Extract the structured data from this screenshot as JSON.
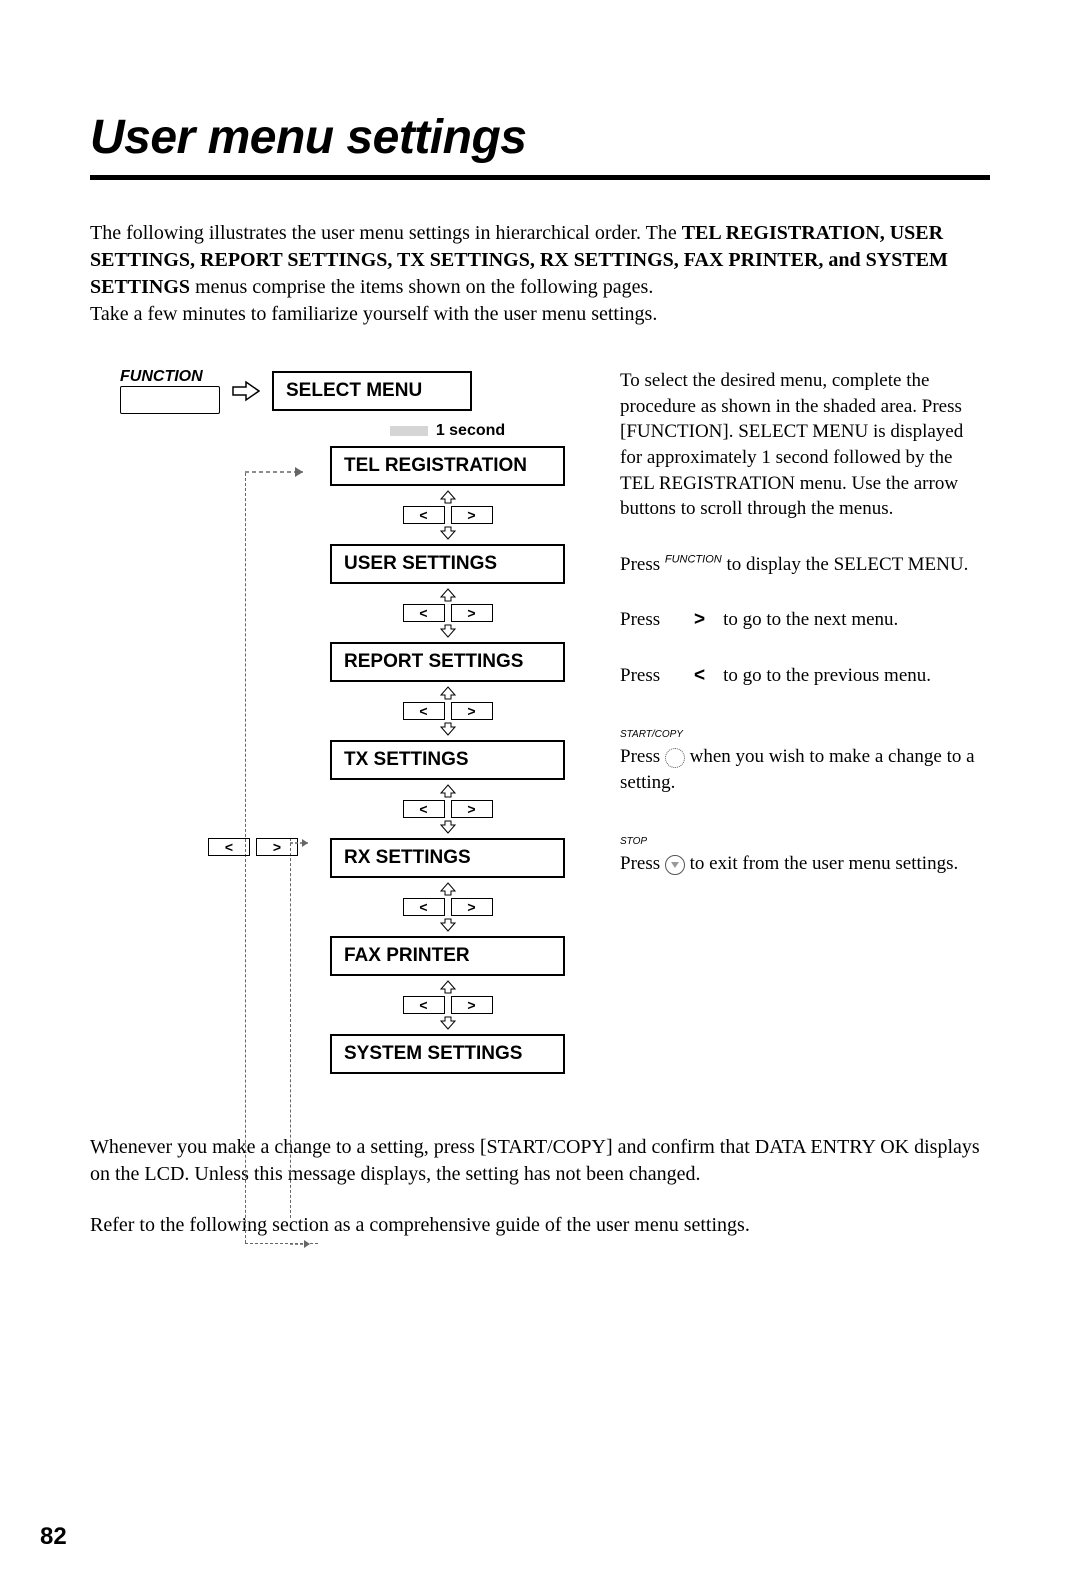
{
  "title": "User menu settings",
  "intro_pre": "The following illustrates the user menu settings in hierarchical order. The ",
  "intro_bold": "TEL REGISTRATION, USER SETTINGS, REPORT SETTINGS, TX SETTINGS, RX SETTINGS, FAX PRINTER, and SYSTEM SETTINGS",
  "intro_post": " menus comprise the items shown on the following pages.",
  "intro_line2": "Take a few minutes to familiarize yourself with the user menu settings.",
  "diagram": {
    "function_label": "FUNCTION",
    "select_menu": "SELECT MENU",
    "one_second": "1 second",
    "menus": {
      "tel_registration": "TEL REGISTRATION",
      "user_settings": "USER SETTINGS",
      "report_settings": "REPORT SETTINGS",
      "tx_settings": "TX SETTINGS",
      "rx_settings": "RX SETTINGS",
      "fax_printer": "FAX PRINTER",
      "system_settings": "SYSTEM SETTINGS"
    },
    "left_glyph": "<",
    "right_glyph": ">"
  },
  "right": {
    "p1": "To select the desired menu, complete the procedure as shown in the shaded area. Press [FUNCTION]. SELECT MENU is displayed for approximately 1 second followed by the TEL REGISTRATION menu. Use the arrow buttons to scroll through the menus.",
    "p2_pre": "Press ",
    "p2_sup": "FUNCTION",
    "p2_post": " to display the SELECT MENU.",
    "press_word": "Press",
    "next_key": ">",
    "next_text": "to go to the next menu.",
    "prev_key": "<",
    "prev_text": "to go to the previous menu.",
    "start_copy_label": "START/COPY",
    "stop_label": "STOP",
    "start_text_pre": "Press ",
    "start_text_post": " when you wish to make a change to a setting.",
    "stop_text_pre": "Press ",
    "stop_text_post": " to exit from the user menu settings."
  },
  "footer1": "Whenever you make a change to a setting, press [START/COPY] and confirm that DATA ENTRY OK displays on the LCD. Unless this message displays, the setting has not been changed.",
  "footer2": "Refer to the following section as a comprehensive guide of the user menu settings.",
  "page_number": "82"
}
